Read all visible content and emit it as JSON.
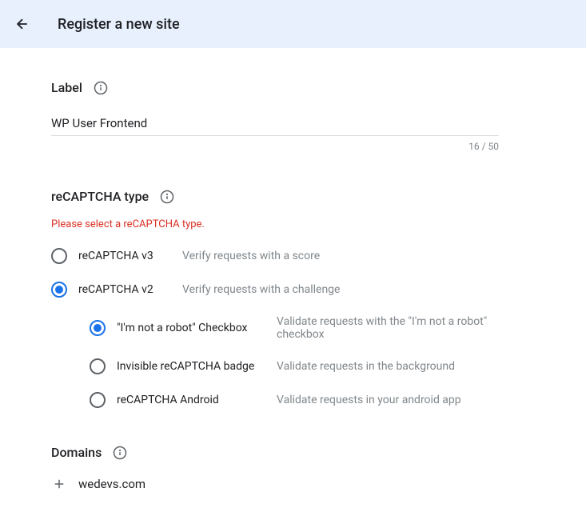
{
  "header": {
    "title": "Register a new site"
  },
  "label_section": {
    "title": "Label",
    "value": "WP User Frontend",
    "char_count": "16 / 50"
  },
  "type_section": {
    "title": "reCAPTCHA type",
    "error": "Please select a reCAPTCHA type.",
    "options": [
      {
        "label": "reCAPTCHA v3",
        "desc": "Verify requests with a score",
        "selected": false
      },
      {
        "label": "reCAPTCHA v2",
        "desc": "Verify requests with a challenge",
        "selected": true
      }
    ],
    "sub_options": [
      {
        "label": "\"I'm not a robot\" Checkbox",
        "desc": "Validate requests with the \"I'm not a robot\" checkbox",
        "selected": true
      },
      {
        "label": "Invisible reCAPTCHA badge",
        "desc": "Validate requests in the background",
        "selected": false
      },
      {
        "label": "reCAPTCHA Android",
        "desc": "Validate requests in your android app",
        "selected": false
      }
    ]
  },
  "domains_section": {
    "title": "Domains",
    "items": [
      "wedevs.com"
    ]
  }
}
